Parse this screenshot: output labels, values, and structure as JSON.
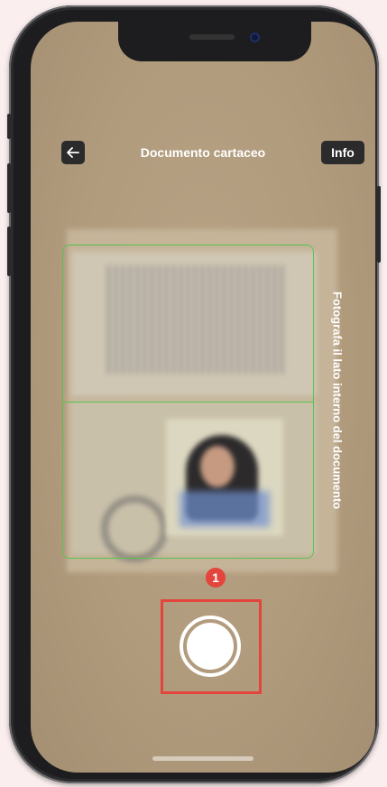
{
  "header": {
    "title": "Documento cartaceo",
    "info_label": "Info",
    "back_icon": "arrow-left-icon"
  },
  "camera": {
    "instruction": "Fotografa il lato interno del documento",
    "capture_icon": "shutter-icon"
  },
  "annotation": {
    "step_number": "1",
    "color": "#e3453c"
  },
  "colors": {
    "frame_guide": "#56c44e",
    "page_background": "#fbeeee",
    "button_bg": "#2b2b2b"
  }
}
